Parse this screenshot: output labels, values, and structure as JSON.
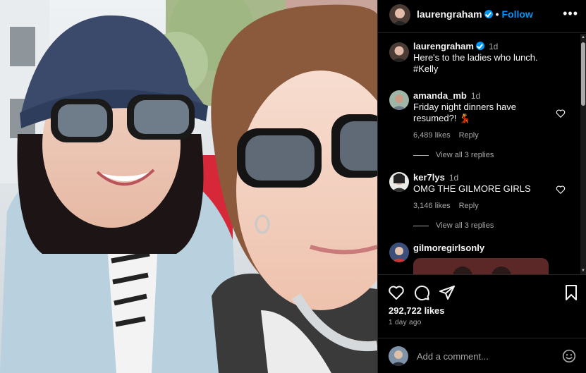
{
  "header": {
    "username": "laurengraham",
    "dot": "•",
    "follow_label": "Follow",
    "more_icon": "more-options-icon"
  },
  "caption": {
    "username": "laurengraham",
    "time": "1d",
    "line1": "Here's to the ladies who lunch.",
    "line2": "#Kelly"
  },
  "comments": [
    {
      "username": "amanda_mb",
      "time": "1d",
      "text": "Friday night dinners have resumed?! 💃",
      "likes": "6,489 likes",
      "reply": "Reply",
      "view_replies": "View all 3 replies"
    },
    {
      "username": "ker7lys",
      "time": "1d",
      "text": "OMG THE GILMORE GIRLS",
      "likes": "3,146 likes",
      "reply": "Reply",
      "view_replies": "View all 3 replies"
    },
    {
      "username": "gilmoregirlsonly"
    }
  ],
  "actions": {
    "likes": "292,722 likes",
    "ago": "1 day ago",
    "icons": [
      "like-icon",
      "comment-icon",
      "share-icon",
      "save-icon"
    ]
  },
  "compose": {
    "placeholder": "Add a comment...",
    "emoji_icon": "emoji-icon"
  },
  "colors": {
    "accent": "#0095f6",
    "background": "#000000",
    "muted": "#a8a8a8",
    "divider": "#262626"
  }
}
